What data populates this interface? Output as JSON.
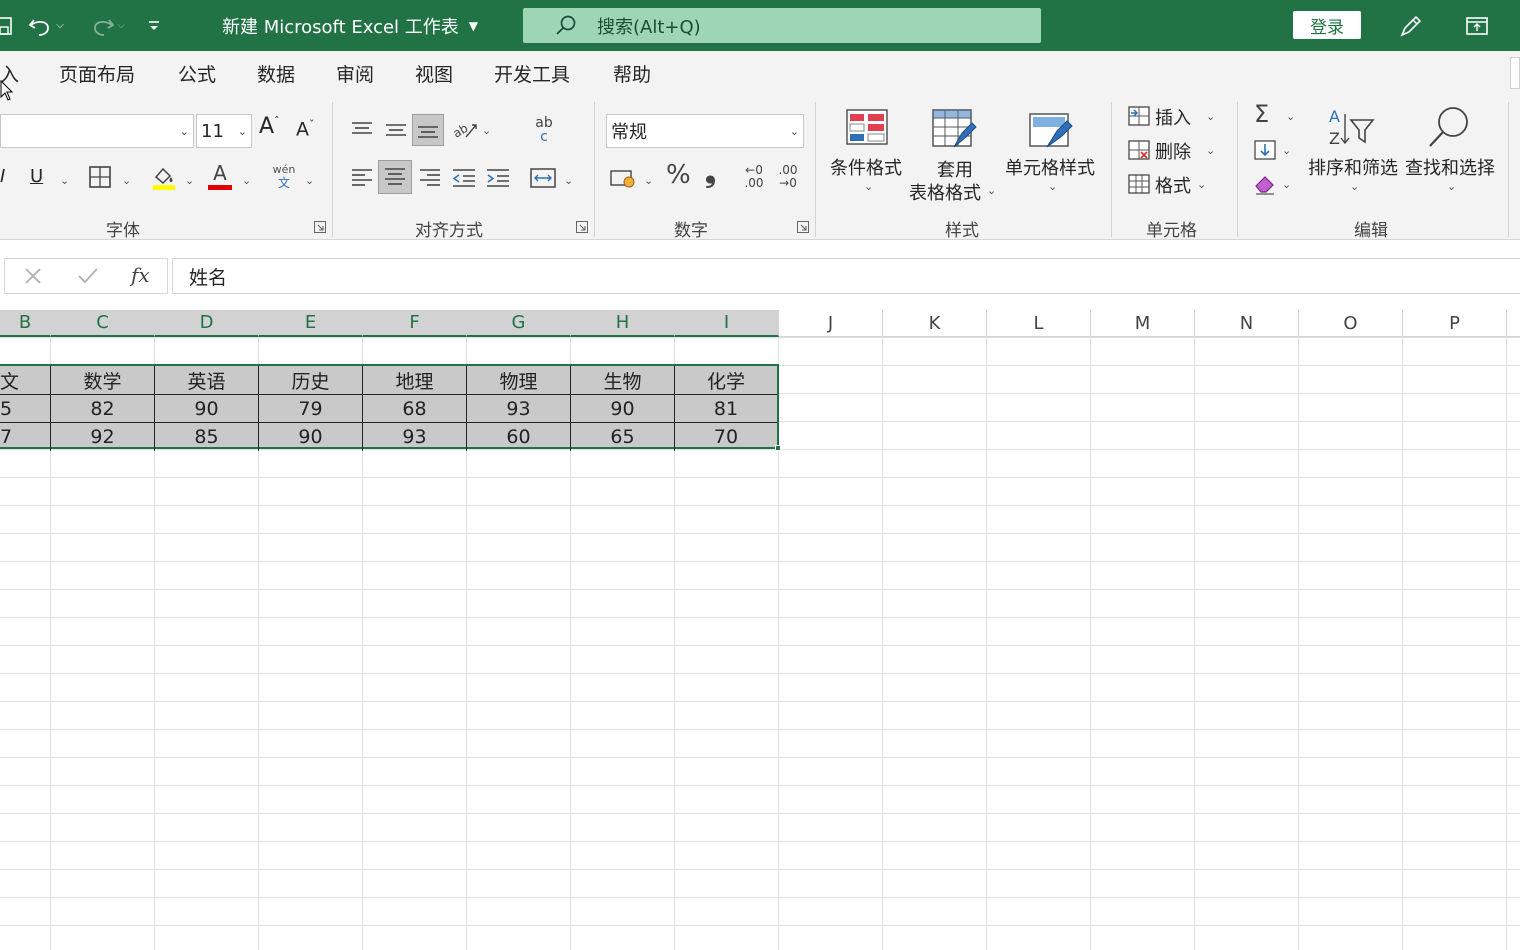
{
  "titlebar": {
    "doc_title": "新建 Microsoft Excel 工作表",
    "search_placeholder": "搜索(Alt+Q)",
    "login_label": "登录"
  },
  "menu": {
    "tabs": [
      "入",
      "页面布局",
      "公式",
      "数据",
      "审阅",
      "视图",
      "开发工具",
      "帮助"
    ]
  },
  "ribbon": {
    "font": {
      "size": "11",
      "label": "字体",
      "phonetic_top": "wén",
      "phonetic_bottom": "文"
    },
    "alignment": {
      "label": "对齐方式",
      "wrap_top": "ab",
      "wrap_bottom": "c"
    },
    "number": {
      "format": "常规",
      "label": "数字",
      "percent": "%",
      "comma": "❟",
      "inc_decimal_top": "←0",
      "inc_decimal_bottom": ".00",
      "dec_decimal_top": ".00",
      "dec_decimal_bottom": "→0"
    },
    "styles": {
      "label": "样式",
      "conditional": "条件格式",
      "table_line1": "套用",
      "table_line2": "表格格式",
      "cell_styles": "单元格样式"
    },
    "cells": {
      "label": "单元格",
      "insert": "插入",
      "delete": "删除",
      "format": "格式"
    },
    "editing": {
      "label": "编辑",
      "sort": "排序和筛选",
      "find": "查找和选择"
    }
  },
  "formula_bar": {
    "fx": "fx",
    "value": "姓名"
  },
  "columns": [
    "B",
    "C",
    "D",
    "E",
    "F",
    "G",
    "H",
    "I",
    "J",
    "K",
    "L",
    "M",
    "N",
    "O",
    "P"
  ],
  "table": {
    "header": [
      "文",
      "数学",
      "英语",
      "历史",
      "地理",
      "物理",
      "生物",
      "化学"
    ],
    "rows": [
      [
        "5",
        "82",
        "90",
        "79",
        "68",
        "93",
        "90",
        "81"
      ],
      [
        "7",
        "92",
        "85",
        "90",
        "93",
        "60",
        "65",
        "70"
      ]
    ]
  },
  "colors": {
    "brand": "#217346",
    "search_bg": "#9fd5b7",
    "selection_fill": "#c9c9c9"
  }
}
